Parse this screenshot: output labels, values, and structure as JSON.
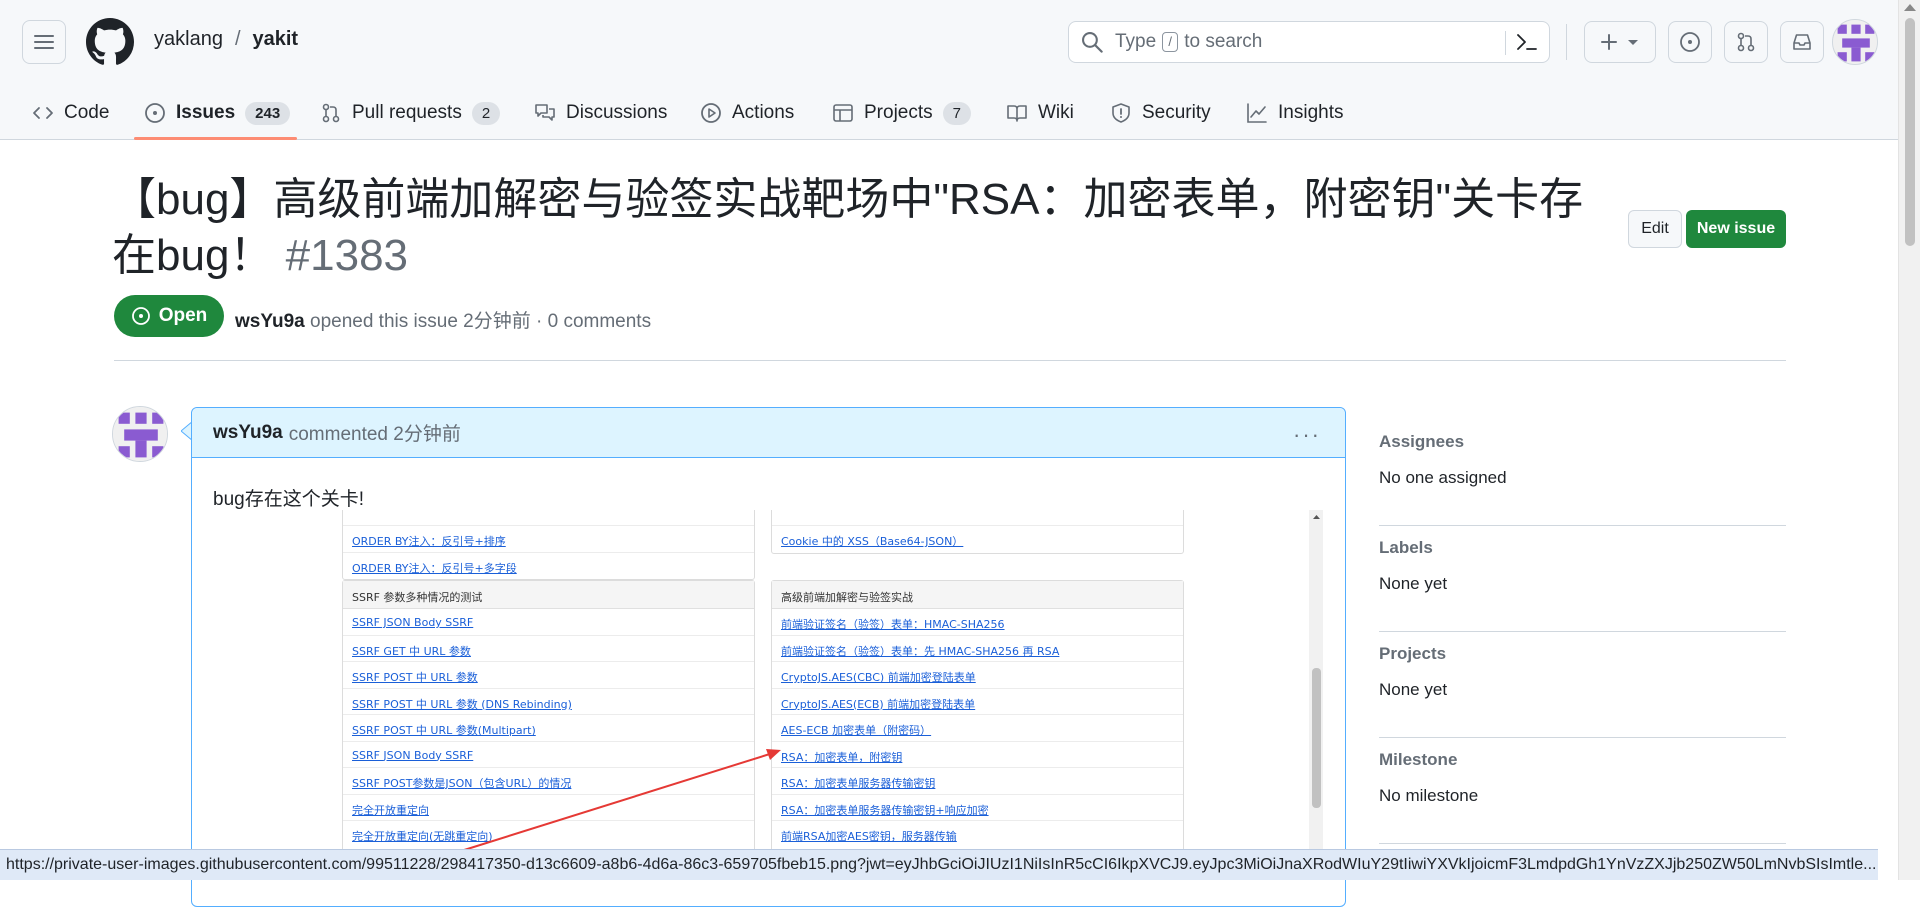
{
  "header": {
    "owner": "yaklang",
    "separator": "/",
    "repo": "yakit",
    "search_placeholder_pre": "Type",
    "search_placeholder_key": "/",
    "search_placeholder_post": "to search"
  },
  "tabs": [
    {
      "label": "Code",
      "icon": "code-icon",
      "count": ""
    },
    {
      "label": "Issues",
      "icon": "issue-opened-icon",
      "count": "243"
    },
    {
      "label": "Pull requests",
      "icon": "git-pull-request-icon",
      "count": "2"
    },
    {
      "label": "Discussions",
      "icon": "comment-discussion-icon",
      "count": ""
    },
    {
      "label": "Actions",
      "icon": "play-icon",
      "count": ""
    },
    {
      "label": "Projects",
      "icon": "table-icon",
      "count": "7"
    },
    {
      "label": "Wiki",
      "icon": "book-icon",
      "count": ""
    },
    {
      "label": "Security",
      "icon": "shield-icon",
      "count": ""
    },
    {
      "label": "Insights",
      "icon": "graph-icon",
      "count": ""
    }
  ],
  "issue": {
    "title": "【bug】高级前端加解密与验签实战靶场中\"RSA：加密表单，附密钥\"关卡存在bug！",
    "number": "#1383",
    "edit_label": "Edit",
    "new_issue_label": "New issue",
    "state": "Open",
    "author": "wsYu9a",
    "meta_rest": "opened this issue 2分钟前 · 0 comments"
  },
  "comment": {
    "author": "wsYu9a",
    "action": "commented 2分钟前",
    "menu": "···",
    "body": "bug存在这个关卡!"
  },
  "screenshot": {
    "left_top_links": [
      "ORDER BY注入：反引号+排序",
      "ORDER BY注入：反引号+多字段"
    ],
    "right_top_links": [
      "Cookie 中的 XSS（Base64-JSON）"
    ],
    "left_panel_title": "SSRF 参数多种情况的测试",
    "left_panel_links": [
      "SSRF JSON Body SSRF",
      "SSRF GET 中 URL 参数",
      "SSRF POST 中 URL 参数",
      "SSRF POST 中 URL 参数 (DNS Rebinding)",
      "SSRF POST 中 URL 参数(Multipart)",
      "SSRF JSON Body SSRF",
      "SSRF POST参数是JSON（包含URL）的情况",
      "完全开放重定向",
      "完全开放重定向(无跳重定向)"
    ],
    "right_panel_title": "高级前端加解密与验签实战",
    "right_panel_links": [
      "前端验证签名（验签）表单：HMAC-SHA256",
      "前端验证签名（验签）表单：先 HMAC-SHA256 再 RSA",
      "CryptoJS.AES(CBC) 前端加密登陆表单",
      "CryptoJS.AES(ECB) 前端加密登陆表单",
      "AES-ECB 加密表单（附密码）",
      "RSA：加密表单，附密钥",
      "RSA：加密表单服务器传输密钥",
      "RSA：加密表单服务器传输密钥+响应加密",
      "前端RSA加密AES密钥，服务器传输"
    ]
  },
  "sidebar": [
    {
      "heading": "Assignees",
      "value": "No one assigned"
    },
    {
      "heading": "Labels",
      "value": "None yet"
    },
    {
      "heading": "Projects",
      "value": "None yet"
    },
    {
      "heading": "Milestone",
      "value": "No milestone"
    }
  ],
  "status_url": "https://private-user-images.githubusercontent.com/99511228/298417350-d13c6609-a8b6-4d6a-86c3-659705fbeb15.png?jwt=eyJhbGciOiJIUzI1NiIsInR5cCI6IkpXVCJ9.eyJpc3MiOiJnaXRodWIuY29tIiwiYXVkIjoicmF3LmdpdGh1YnVzZXJjb250ZW50LmNvbSIsImtle...",
  "colors": {
    "accent_green": "#1f883d",
    "tab_underline": "#fd8c73",
    "comment_header": "#ddf4ff",
    "comment_border": "#54aeff",
    "annotation_arrow": "#e53935"
  }
}
